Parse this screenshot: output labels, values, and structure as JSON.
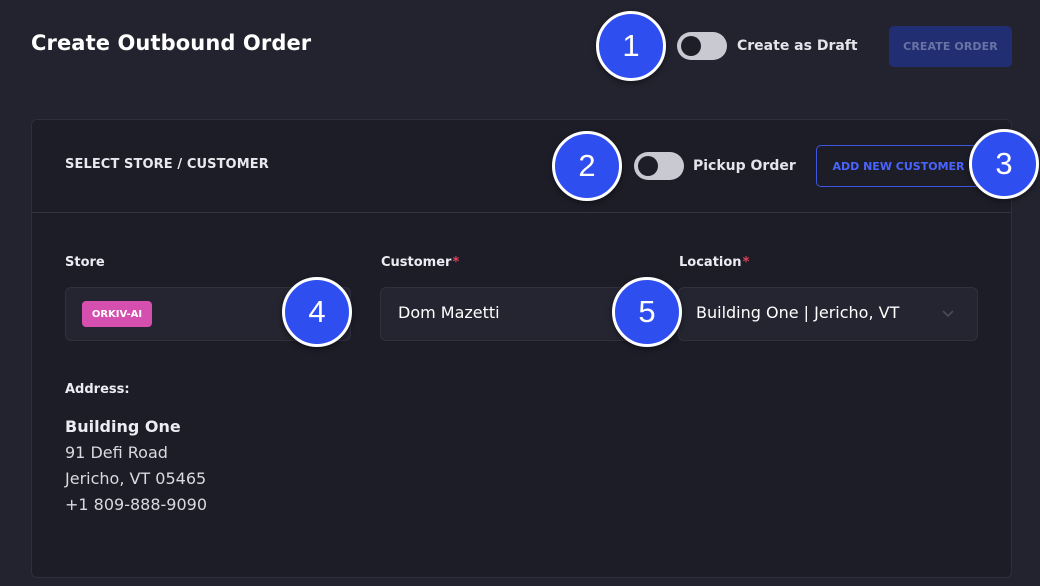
{
  "header": {
    "title": "Create Outbound Order",
    "draft_toggle_label": "Create as Draft",
    "draft_toggle_on": false,
    "create_order_label": "CREATE ORDER"
  },
  "section": {
    "title": "SELECT STORE / CUSTOMER",
    "pickup_toggle_label": "Pickup Order",
    "pickup_toggle_on": false,
    "add_customer_label": "ADD NEW CUSTOMER"
  },
  "fields": {
    "store_label": "Store",
    "store_value": "ORKIV-AI",
    "customer_label": "Customer",
    "customer_value": "Dom Mazetti",
    "location_label": "Location",
    "location_value": "Building One | Jericho, VT",
    "required_mark": "*"
  },
  "address": {
    "label": "Address:",
    "name": "Building One",
    "street": "91 Defi Road",
    "city_line": "Jericho, VT 05465",
    "phone": "+1 809-888-9090"
  },
  "markers": [
    "1",
    "2",
    "3",
    "4",
    "5"
  ],
  "colors": {
    "background": "#23232f",
    "card": "#1d1d28",
    "accent": "#3e56e0",
    "marker": "#2f4ef0",
    "store_badge": "#d44fae",
    "required": "#e34158"
  },
  "icons": {
    "location_dropdown": "chevron-down-icon"
  }
}
